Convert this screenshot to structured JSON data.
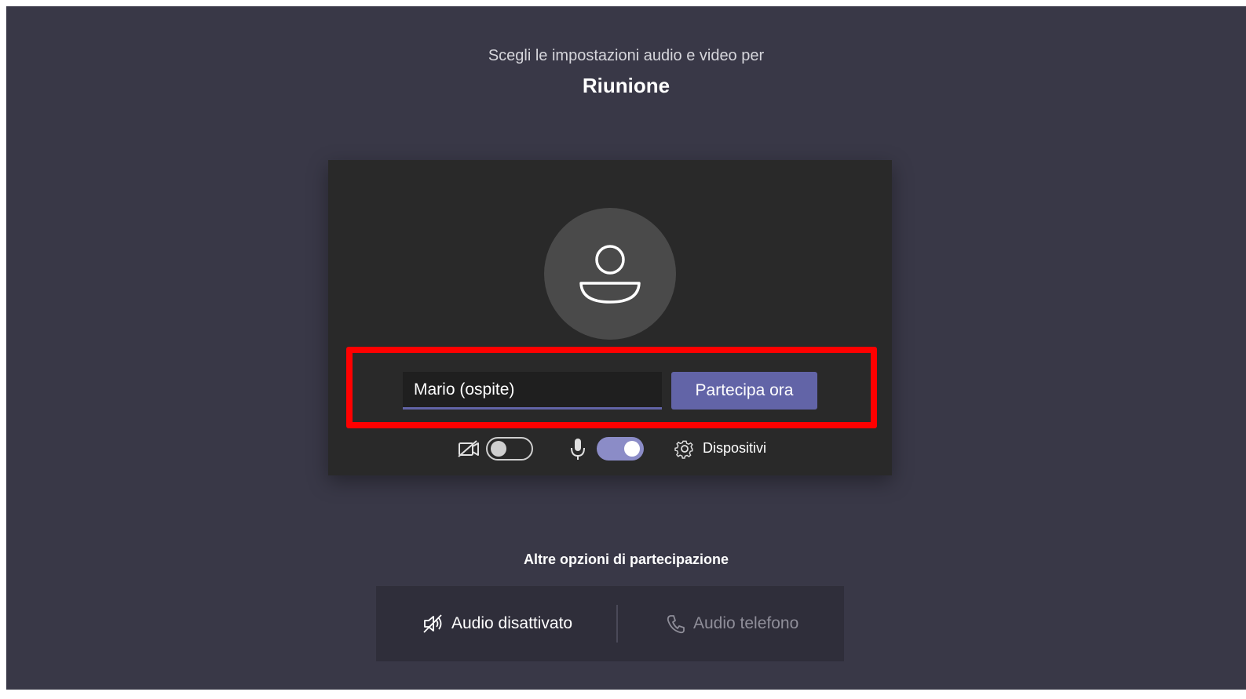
{
  "header": {
    "subtitle": "Scegli le impostazioni audio e video per",
    "meeting_title": "Riunione"
  },
  "prejoin": {
    "name_input_value": "Mario (ospite)",
    "join_button_label": "Partecipa ora",
    "camera_toggle_on": false,
    "mic_toggle_on": true,
    "devices_label": "Dispositivi"
  },
  "other_options": {
    "heading": "Altre opzioni di partecipazione",
    "audio_off_label": "Audio disattivato",
    "phone_audio_label": "Audio telefono"
  },
  "colors": {
    "background": "#393847",
    "card": "#292929",
    "accent": "#6264a7",
    "highlight": "#ff0000"
  },
  "icons": [
    "user-avatar-icon",
    "camera-off-icon",
    "microphone-icon",
    "gear-icon",
    "speaker-off-icon",
    "phone-icon"
  ]
}
